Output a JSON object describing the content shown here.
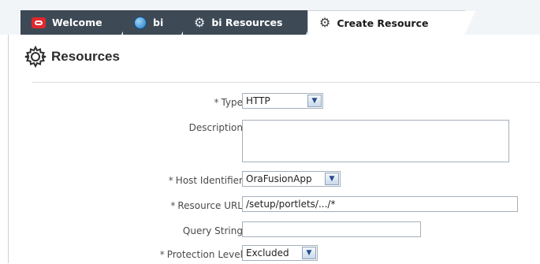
{
  "tabs": [
    {
      "label": "Welcome",
      "icon": "oracle-icon"
    },
    {
      "label": "bi",
      "icon": "globe-icon"
    },
    {
      "label": "bi Resources",
      "icon": "gear-icon"
    },
    {
      "label": "Create Resource",
      "icon": "gear-icon",
      "active": true
    }
  ],
  "header": {
    "title": "Resources",
    "icon": "gear-icon"
  },
  "form": {
    "required_marker": "*",
    "type": {
      "label": "Type",
      "value": "HTTP"
    },
    "description": {
      "label": "Description",
      "value": ""
    },
    "host_identifier": {
      "label": "Host Identifier",
      "value": "OraFusionApp"
    },
    "resource_url": {
      "label": "Resource URL",
      "value": "/setup/portlets/.../*"
    },
    "query_string": {
      "label": "Query String",
      "value": ""
    },
    "protection_level": {
      "label": "Protection Level",
      "value": "Excluded"
    }
  },
  "colors": {
    "tab_dark": "#3d4a56",
    "accent_red": "#e0282c",
    "panel_border": "#c9d2da"
  }
}
